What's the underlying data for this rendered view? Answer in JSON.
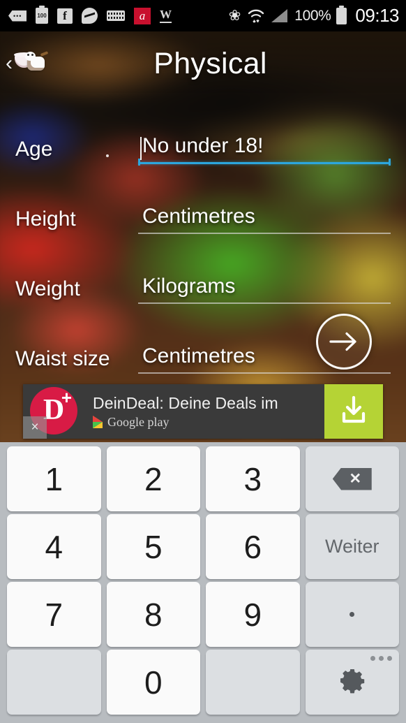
{
  "status_bar": {
    "icons": [
      "dots-tag-icon",
      "battery-saver-100-icon",
      "facebook-icon",
      "messenger-icon",
      "keyboard-icon",
      "avira-icon",
      "wikipedia-icon"
    ],
    "battery_level_label": "100",
    "facebook_letter": "f",
    "avira_letter": "a",
    "wikipedia_letter": "W",
    "bluetooth_icon": "bluetooth-icon",
    "wifi_icon": "wifi-transfer-icon",
    "signal_icon": "cell-signal-icon",
    "battery_percent": "100%",
    "battery_icon": "battery-full-icon",
    "clock": "09:13"
  },
  "header": {
    "back_label": "‹",
    "app_icon": "cow-milk-icon",
    "title": "Physical"
  },
  "form": {
    "fields": [
      {
        "label": "Age",
        "value": "No under 18!",
        "focused": true
      },
      {
        "label": "Height",
        "value": "Centimetres",
        "focused": false
      },
      {
        "label": "Weight",
        "value": "Kilograms",
        "focused": false
      },
      {
        "label": "Waist size",
        "value": "Centimetres",
        "focused": false
      }
    ],
    "next_button_icon": "arrow-right-icon",
    "focus_accent_color": "#2ca6dd"
  },
  "ad": {
    "logo_letter": "D",
    "logo_badge": "+",
    "logo_color": "#d81b45",
    "title": "DeinDeal: Deine Deals im",
    "store_label": "Google play",
    "store_icon": "google-play-icon",
    "close_label": "×",
    "cta_icon": "download-icon",
    "cta_color": "#b5d335"
  },
  "keyboard": {
    "background_color": "#b8bcc0",
    "rows": [
      [
        {
          "type": "digit",
          "label": "1",
          "name": "key-1"
        },
        {
          "type": "digit",
          "label": "2",
          "name": "key-2"
        },
        {
          "type": "digit",
          "label": "3",
          "name": "key-3"
        },
        {
          "type": "icon",
          "label": "",
          "name": "key-backspace",
          "icon": "backspace-icon"
        }
      ],
      [
        {
          "type": "digit",
          "label": "4",
          "name": "key-4"
        },
        {
          "type": "digit",
          "label": "5",
          "name": "key-5"
        },
        {
          "type": "digit",
          "label": "6",
          "name": "key-6"
        },
        {
          "type": "word",
          "label": "Weiter",
          "name": "key-next"
        }
      ],
      [
        {
          "type": "digit",
          "label": "7",
          "name": "key-7"
        },
        {
          "type": "digit",
          "label": "8",
          "name": "key-8"
        },
        {
          "type": "digit",
          "label": "9",
          "name": "key-9"
        },
        {
          "type": "dot",
          "label": ".",
          "name": "key-period"
        }
      ],
      [
        {
          "type": "blank",
          "label": "",
          "name": "key-blank-left"
        },
        {
          "type": "digit",
          "label": "0",
          "name": "key-0"
        },
        {
          "type": "blank",
          "label": "",
          "name": "key-blank-right"
        },
        {
          "type": "icon",
          "label": "",
          "name": "key-settings",
          "icon": "gear-icon"
        }
      ]
    ]
  }
}
